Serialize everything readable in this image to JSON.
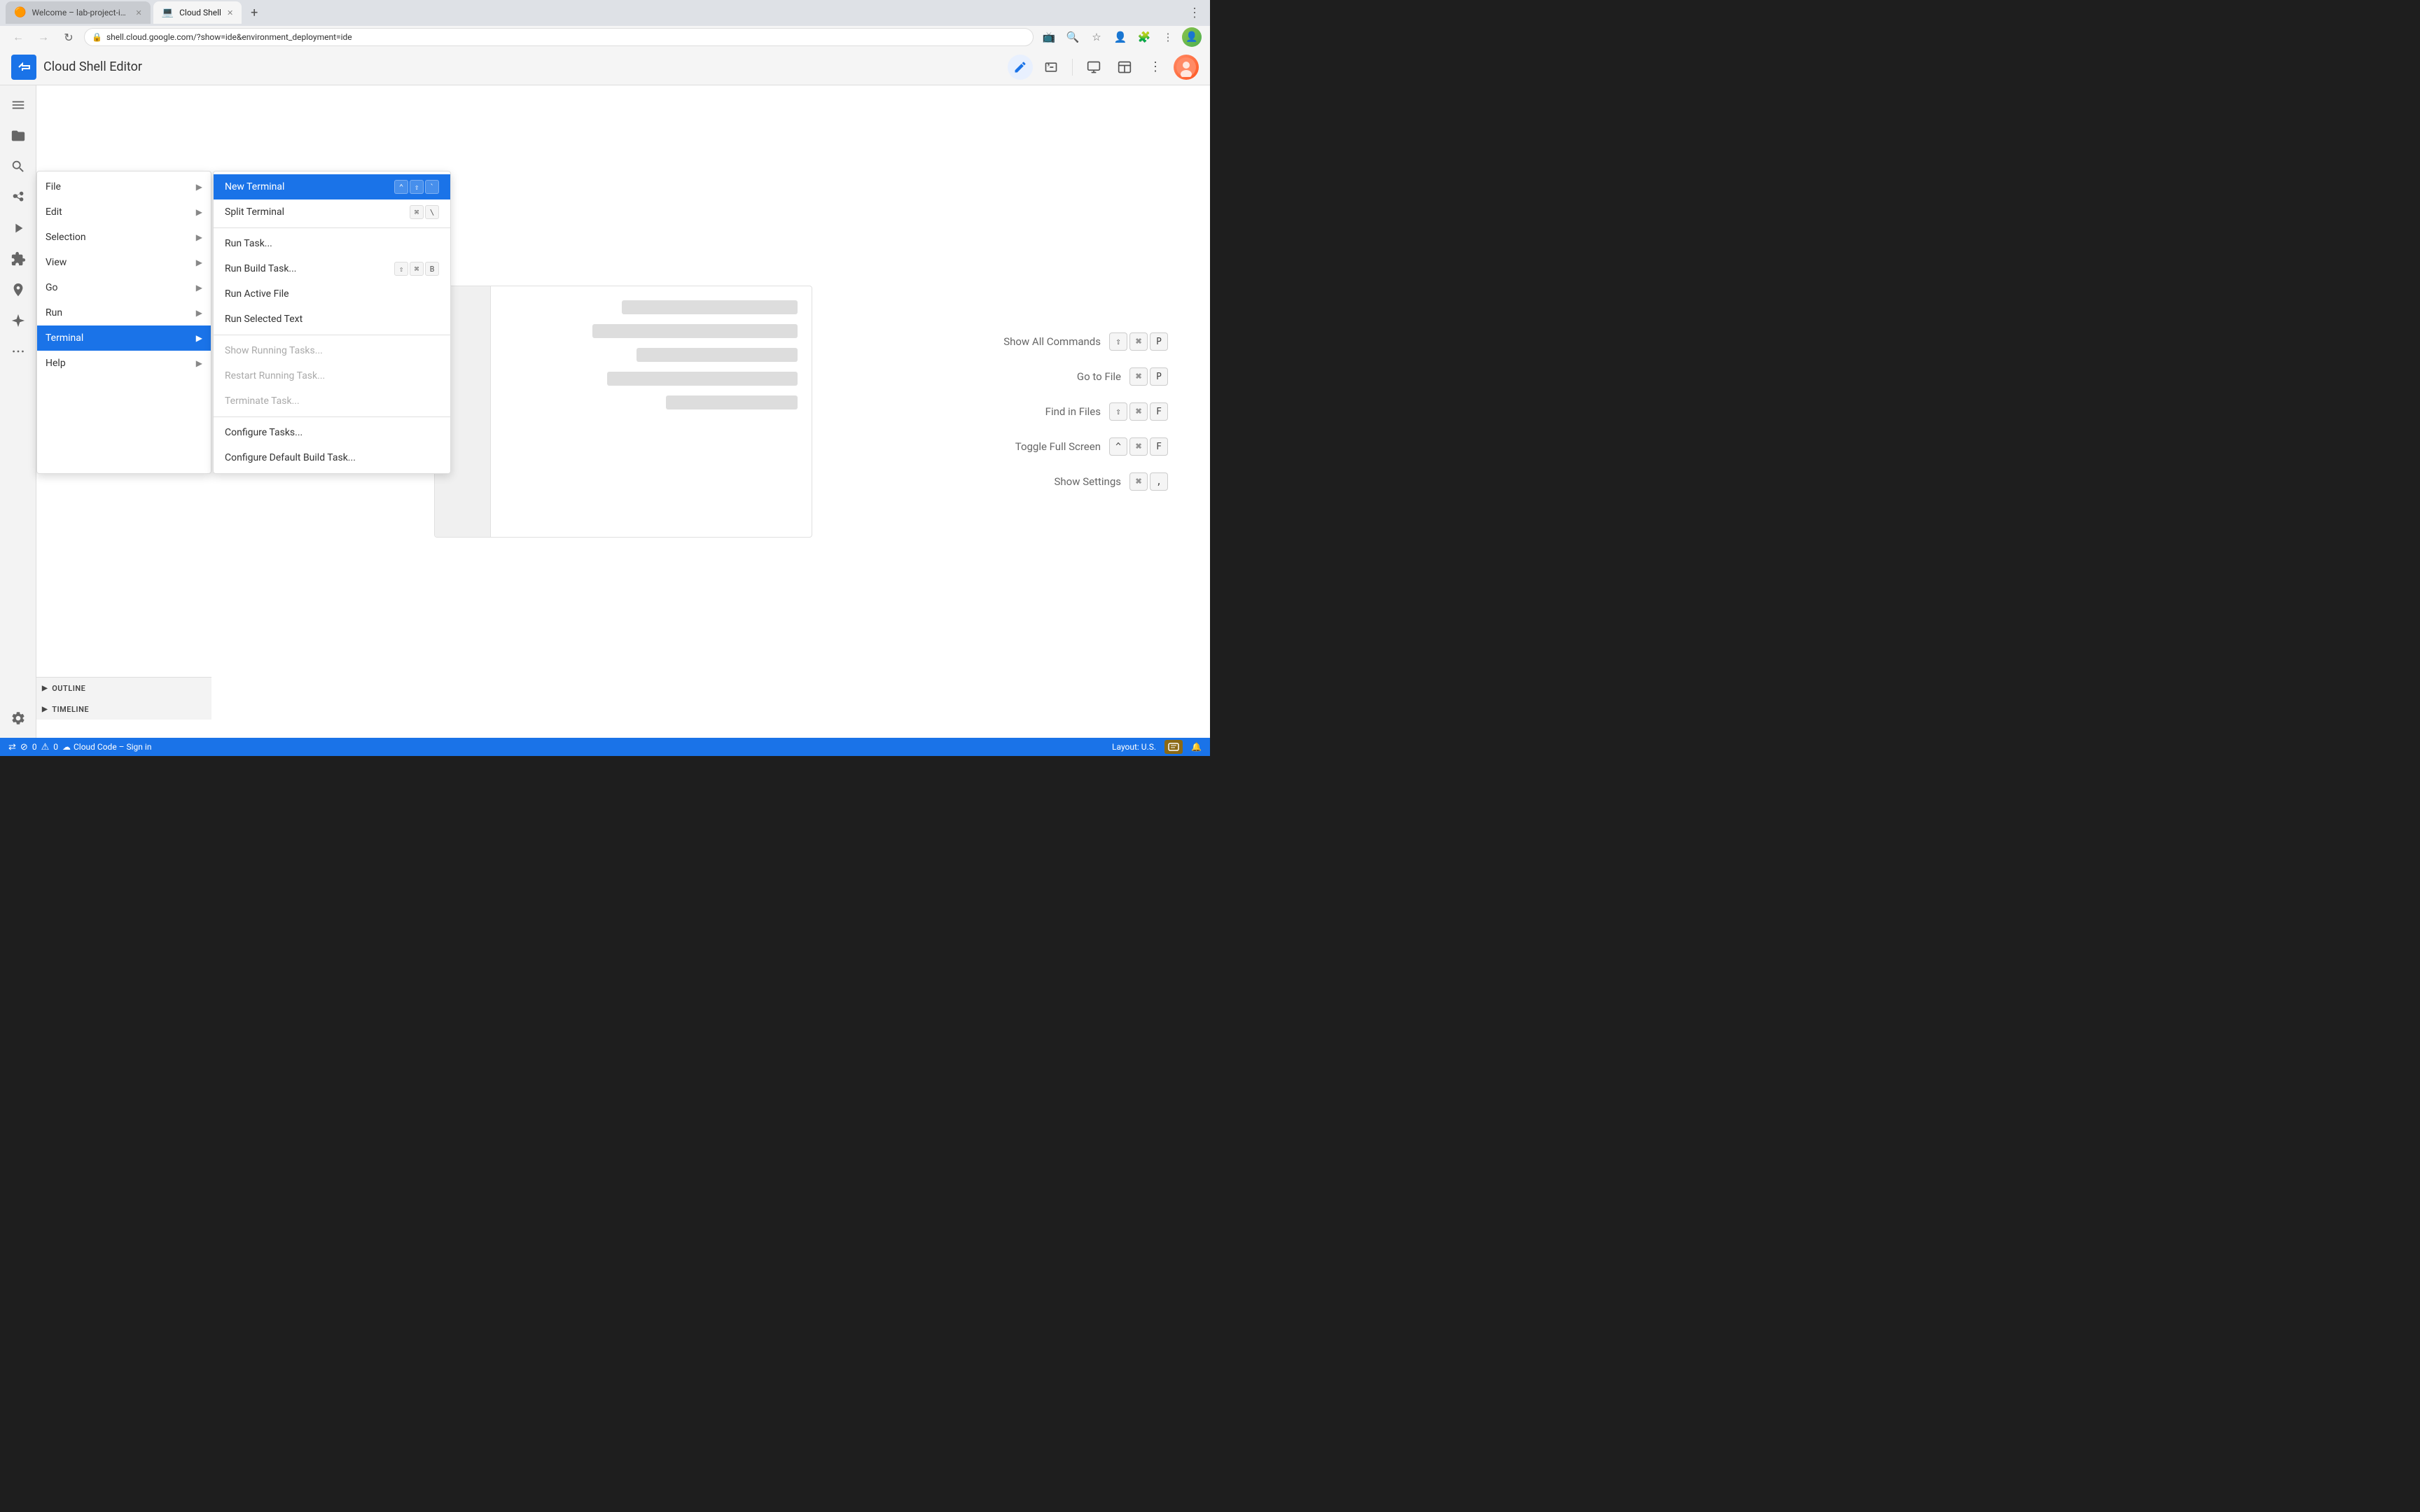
{
  "browser": {
    "tabs": [
      {
        "id": "tab-welcome",
        "title": "Welcome – lab-project-id-e...",
        "favicon": "🟠",
        "active": false
      },
      {
        "id": "tab-cloudshell",
        "title": "Cloud Shell",
        "favicon": "🔵",
        "active": true
      }
    ],
    "address": "shell.cloud.google.com/?show=ide&environment_deployment=ide",
    "nav_buttons": {
      "back": "←",
      "forward": "→",
      "reload": "↻"
    }
  },
  "app": {
    "title": "Cloud Shell Editor",
    "logo_symbol": "≫"
  },
  "header_buttons": [
    {
      "id": "edit-icon",
      "symbol": "✏",
      "active": true
    },
    {
      "id": "terminal-icon",
      "symbol": ">_",
      "active": false
    },
    {
      "id": "preview-icon",
      "symbol": "⬜",
      "active": false
    },
    {
      "id": "layout-icon",
      "symbol": "⬛",
      "active": false
    },
    {
      "id": "more-icon",
      "symbol": "⋮",
      "active": false
    }
  ],
  "activity_bar": {
    "items": [
      {
        "id": "menu",
        "symbol": "☰",
        "label": "menu-icon"
      },
      {
        "id": "files",
        "symbol": "📄",
        "label": "files-icon"
      },
      {
        "id": "search",
        "symbol": "🔍",
        "label": "search-icon"
      },
      {
        "id": "source-control",
        "symbol": "⎇",
        "label": "source-control-icon"
      },
      {
        "id": "run-debug",
        "symbol": "▶",
        "label": "run-debug-icon"
      },
      {
        "id": "extensions",
        "symbol": "⊞",
        "label": "extensions-icon"
      },
      {
        "id": "cloud-code",
        "symbol": "◆",
        "label": "cloud-code-icon"
      },
      {
        "id": "gemini",
        "symbol": "✦",
        "label": "gemini-icon"
      },
      {
        "id": "more-dots",
        "symbol": "···",
        "label": "more-dots-icon"
      }
    ],
    "bottom_items": [
      {
        "id": "settings",
        "symbol": "⚙",
        "label": "settings-icon"
      }
    ]
  },
  "primary_menu": {
    "items": [
      {
        "id": "file",
        "label": "File",
        "has_submenu": true
      },
      {
        "id": "edit",
        "label": "Edit",
        "has_submenu": true
      },
      {
        "id": "selection",
        "label": "Selection",
        "has_submenu": true
      },
      {
        "id": "view",
        "label": "View",
        "has_submenu": true
      },
      {
        "id": "go",
        "label": "Go",
        "has_submenu": true
      },
      {
        "id": "run",
        "label": "Run",
        "has_submenu": true
      },
      {
        "id": "terminal",
        "label": "Terminal",
        "has_submenu": true,
        "highlighted": true
      },
      {
        "id": "help",
        "label": "Help",
        "has_submenu": true
      }
    ]
  },
  "terminal_submenu": {
    "items": [
      {
        "id": "new-terminal",
        "label": "New Terminal",
        "shortcut": "⌃⇧`",
        "disabled": false,
        "highlighted": true
      },
      {
        "id": "split-terminal",
        "label": "Split Terminal",
        "shortcut": "⌘\\",
        "disabled": false
      },
      {
        "id": "divider1",
        "type": "divider"
      },
      {
        "id": "run-task",
        "label": "Run Task...",
        "shortcut": "",
        "disabled": false
      },
      {
        "id": "run-build-task",
        "label": "Run Build Task...",
        "shortcut": "⇧⌘B",
        "disabled": false
      },
      {
        "id": "run-active-file",
        "label": "Run Active File",
        "shortcut": "",
        "disabled": false
      },
      {
        "id": "run-selected-text",
        "label": "Run Selected Text",
        "shortcut": "",
        "disabled": false
      },
      {
        "id": "divider2",
        "type": "divider"
      },
      {
        "id": "show-running-tasks",
        "label": "Show Running Tasks...",
        "shortcut": "",
        "disabled": true
      },
      {
        "id": "restart-running-task",
        "label": "Restart Running Task...",
        "shortcut": "",
        "disabled": true
      },
      {
        "id": "terminate-task",
        "label": "Terminate Task...",
        "shortcut": "",
        "disabled": true
      },
      {
        "id": "divider3",
        "type": "divider"
      },
      {
        "id": "configure-tasks",
        "label": "Configure Tasks...",
        "shortcut": "",
        "disabled": false
      },
      {
        "id": "configure-default-build-task",
        "label": "Configure Default Build Task...",
        "shortcut": "",
        "disabled": false
      }
    ]
  },
  "shortcuts": [
    {
      "id": "show-all-commands",
      "label": "Show All Commands",
      "keys": [
        "⇧",
        "⌘",
        "P"
      ]
    },
    {
      "id": "go-to-file",
      "label": "Go to File",
      "keys": [
        "⌘",
        "P"
      ]
    },
    {
      "id": "find-in-files",
      "label": "Find in Files",
      "keys": [
        "⇧",
        "⌘",
        "F"
      ]
    },
    {
      "id": "toggle-full-screen",
      "label": "Toggle Full Screen",
      "keys": [
        "^",
        "⌘",
        "F"
      ]
    },
    {
      "id": "show-settings",
      "label": "Show Settings",
      "keys": [
        "⌘",
        ","
      ]
    }
  ],
  "bottom_panels": [
    {
      "id": "outline",
      "label": "OUTLINE"
    },
    {
      "id": "timeline",
      "label": "TIMELINE"
    }
  ],
  "status_bar": {
    "left": [
      {
        "id": "remote-icon",
        "symbol": "><",
        "label": "remote-icon"
      },
      {
        "id": "errors",
        "symbol": "⊘",
        "count": "0",
        "label": "errors-count"
      },
      {
        "id": "warnings",
        "symbol": "⚠",
        "count": "0",
        "label": "warnings-count"
      },
      {
        "id": "cloud-code",
        "symbol": "☁",
        "text": "Cloud Code – Sign in",
        "label": "cloud-code-status"
      }
    ],
    "right": [
      {
        "id": "layout",
        "text": "Layout: U.S.",
        "label": "layout-indicator"
      },
      {
        "id": "bell",
        "symbol": "🔔",
        "label": "notifications-icon"
      }
    ]
  }
}
